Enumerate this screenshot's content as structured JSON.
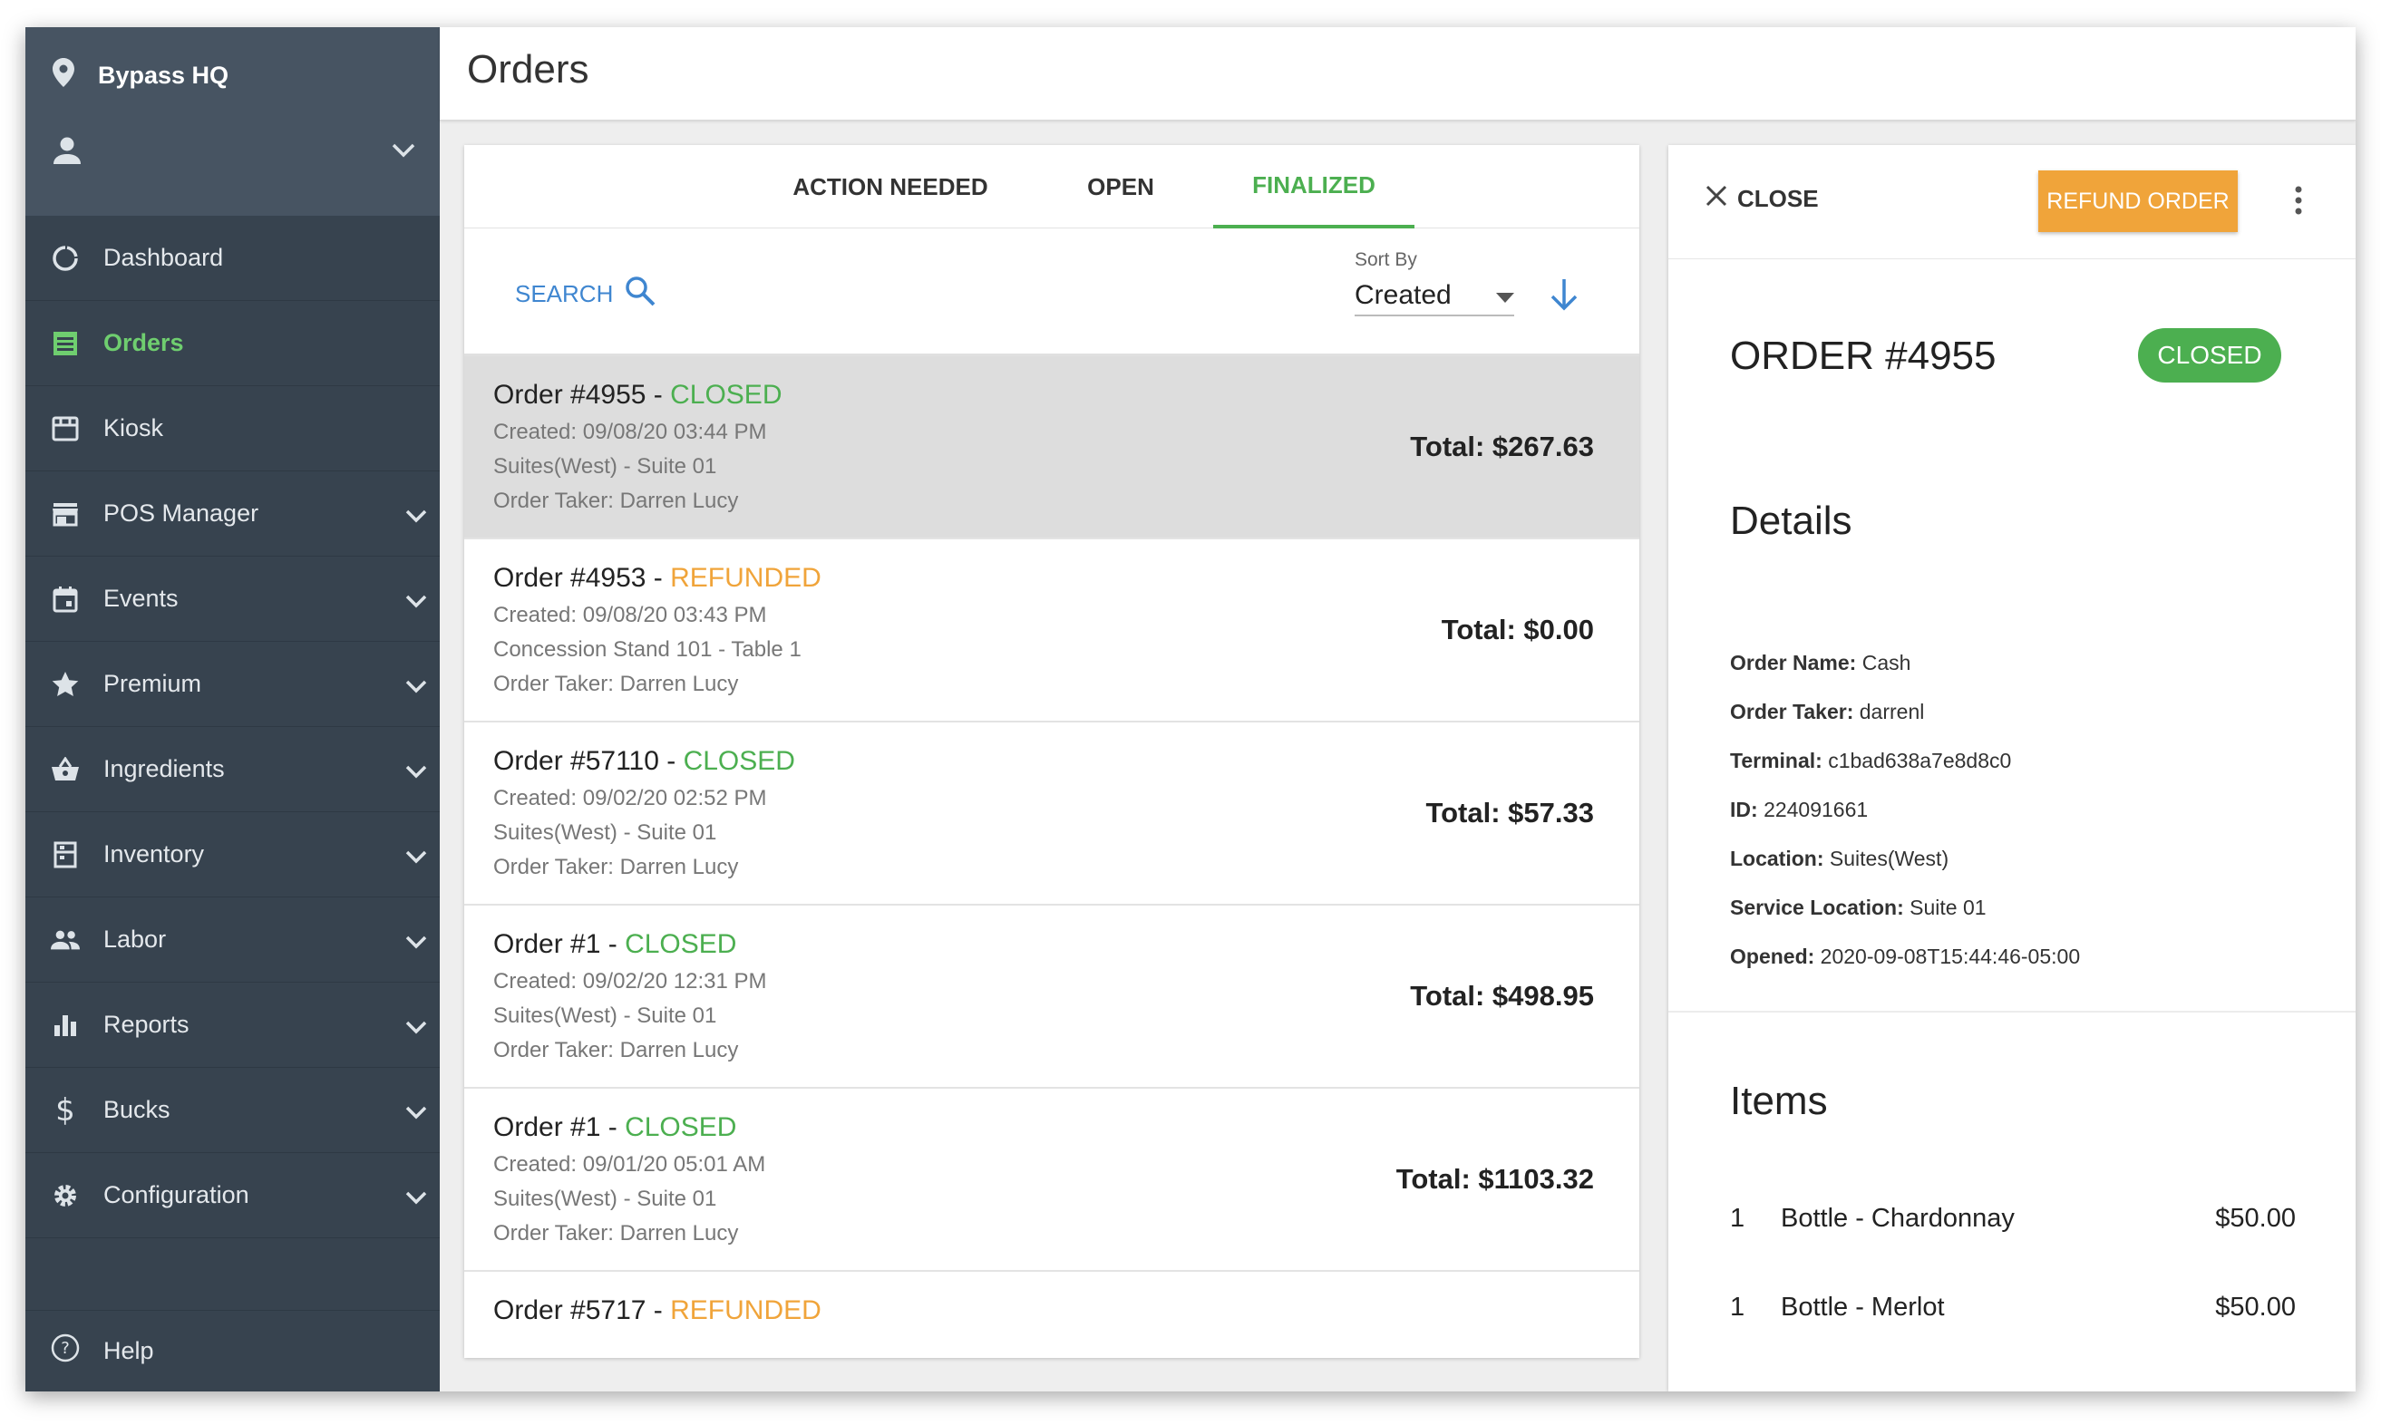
{
  "sidebar": {
    "venue": "Bypass HQ",
    "items": [
      {
        "label": "Dashboard",
        "icon": "dashboard-icon",
        "has_children": false
      },
      {
        "label": "Orders",
        "icon": "orders-icon",
        "has_children": false,
        "active": true
      },
      {
        "label": "Kiosk",
        "icon": "kiosk-icon",
        "has_children": false
      },
      {
        "label": "POS Manager",
        "icon": "store-icon",
        "has_children": true
      },
      {
        "label": "Events",
        "icon": "calendar-icon",
        "has_children": true
      },
      {
        "label": "Premium",
        "icon": "star-icon",
        "has_children": true
      },
      {
        "label": "Ingredients",
        "icon": "basket-icon",
        "has_children": true
      },
      {
        "label": "Inventory",
        "icon": "inventory-icon",
        "has_children": true
      },
      {
        "label": "Labor",
        "icon": "people-icon",
        "has_children": true
      },
      {
        "label": "Reports",
        "icon": "bar-chart-icon",
        "has_children": true
      },
      {
        "label": "Bucks",
        "icon": "dollar-icon",
        "has_children": true
      },
      {
        "label": "Configuration",
        "icon": "gear-icon",
        "has_children": true
      }
    ],
    "help": "Help"
  },
  "header": {
    "title": "Orders"
  },
  "tabs": [
    {
      "label": "ACTION NEEDED",
      "active": false
    },
    {
      "label": "OPEN",
      "active": false
    },
    {
      "label": "FINALIZED",
      "active": true
    }
  ],
  "toolbar": {
    "search_label": "SEARCH",
    "sort_label": "Sort By",
    "sort_value": "Created"
  },
  "orders": [
    {
      "title": "Order #4955 - ",
      "status": "CLOSED",
      "created": "Created: 09/08/20 03:44 PM",
      "location": "Suites(West) - Suite 01",
      "taker": "Order Taker: Darren Lucy",
      "total": "Total: $267.63",
      "selected": true
    },
    {
      "title": "Order #4953 - ",
      "status": "REFUNDED",
      "created": "Created: 09/08/20 03:43 PM",
      "location": "Concession Stand 101 - Table 1",
      "taker": "Order Taker: Darren Lucy",
      "total": "Total: $0.00"
    },
    {
      "title": "Order #57110 - ",
      "status": "CLOSED",
      "created": "Created: 09/02/20 02:52 PM",
      "location": "Suites(West) - Suite 01",
      "taker": "Order Taker: Darren Lucy",
      "total": "Total: $57.33"
    },
    {
      "title": "Order #1 - ",
      "status": "CLOSED",
      "created": "Created: 09/02/20 12:31 PM",
      "location": "Suites(West) - Suite 01",
      "taker": "Order Taker: Darren Lucy",
      "total": "Total: $498.95"
    },
    {
      "title": "Order #1 - ",
      "status": "CLOSED",
      "created": "Created: 09/01/20 05:01 AM",
      "location": "Suites(West) - Suite 01",
      "taker": "Order Taker: Darren Lucy",
      "total": "Total: $1103.32"
    },
    {
      "title": "Order #5717 - ",
      "status": "REFUNDED",
      "created": "",
      "location": "",
      "taker": "",
      "total": ""
    }
  ],
  "detail": {
    "close_label": "CLOSE",
    "refund_label": "REFUND ORDER",
    "order_number": "ORDER #4955",
    "status": "CLOSED",
    "details_heading": "Details",
    "fields": [
      {
        "label": "Order Name:",
        "value": "Cash"
      },
      {
        "label": "Order Taker:",
        "value": "darrenl"
      },
      {
        "label": "Terminal:",
        "value": "c1bad638a7e8d8c0"
      },
      {
        "label": "ID:",
        "value": "224091661"
      },
      {
        "label": "Location:",
        "value": "Suites(West)"
      },
      {
        "label": "Service Location:",
        "value": "Suite 01"
      },
      {
        "label": "Opened:",
        "value": "2020-09-08T15:44:46-05:00"
      }
    ],
    "items_heading": "Items",
    "items": [
      {
        "qty": "1",
        "name": "Bottle - Chardonnay",
        "price": "$50.00"
      },
      {
        "qty": "1",
        "name": "Bottle - Merlot",
        "price": "$50.00"
      }
    ]
  },
  "colors": {
    "sidebar_bg": "#37434f",
    "sidebar_header_bg": "#475462",
    "accent_green": "#4caf50",
    "refund_orange": "#f0a43a",
    "link_blue": "#3f86d0"
  }
}
